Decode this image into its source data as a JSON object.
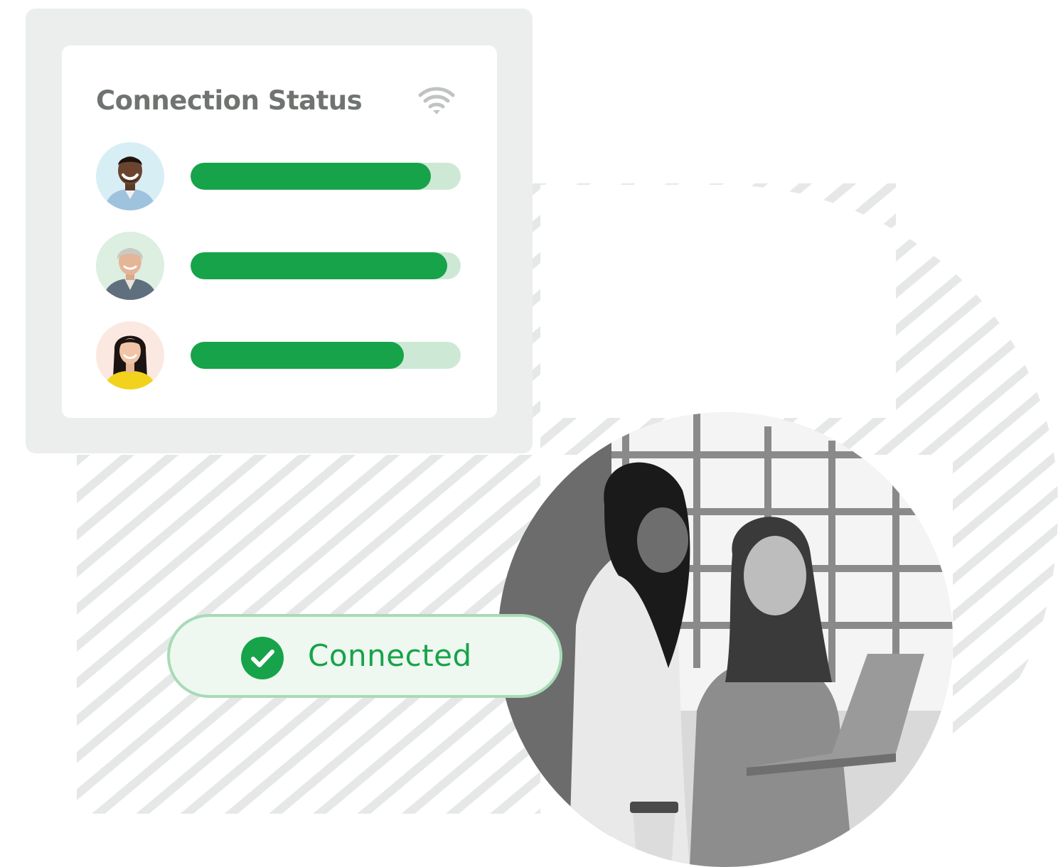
{
  "card": {
    "title": "Connection Status",
    "icon": "wifi-icon",
    "rows": [
      {
        "avatar": "avatar-man-smiling",
        "signal": 0.89
      },
      {
        "avatar": "avatar-woman-gray-hair",
        "signal": 0.95
      },
      {
        "avatar": "avatar-woman-yellow-top",
        "signal": 0.79
      }
    ]
  },
  "status": {
    "label": "Connected",
    "icon": "check-circle-icon"
  },
  "colors": {
    "accent_green": "#17a349",
    "track_green": "#cde9d6",
    "pill_border": "#a6dbb6",
    "pill_bg": "#eef8f1",
    "card_bg": "#eceeed",
    "title_gray": "#6f7471"
  }
}
